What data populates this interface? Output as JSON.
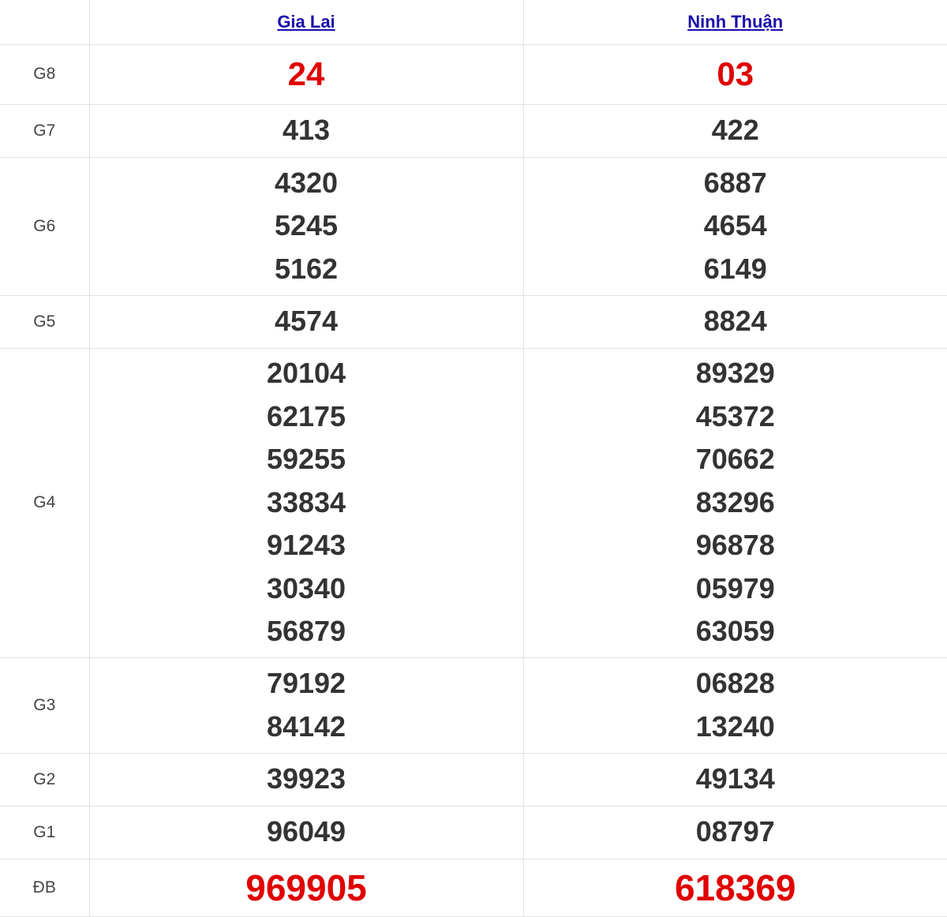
{
  "header": {
    "provinces": [
      "Gia Lai",
      "Ninh Thuận"
    ]
  },
  "prizes": {
    "g8": {
      "label": "G8",
      "gia_lai": [
        "24"
      ],
      "ninh_thuan": [
        "03"
      ]
    },
    "g7": {
      "label": "G7",
      "gia_lai": [
        "413"
      ],
      "ninh_thuan": [
        "422"
      ]
    },
    "g6": {
      "label": "G6",
      "gia_lai": [
        "4320",
        "5245",
        "5162"
      ],
      "ninh_thuan": [
        "6887",
        "4654",
        "6149"
      ]
    },
    "g5": {
      "label": "G5",
      "gia_lai": [
        "4574"
      ],
      "ninh_thuan": [
        "8824"
      ]
    },
    "g4": {
      "label": "G4",
      "gia_lai": [
        "20104",
        "62175",
        "59255",
        "33834",
        "91243",
        "30340",
        "56879"
      ],
      "ninh_thuan": [
        "89329",
        "45372",
        "70662",
        "83296",
        "96878",
        "05979",
        "63059"
      ]
    },
    "g3": {
      "label": "G3",
      "gia_lai": [
        "79192",
        "84142"
      ],
      "ninh_thuan": [
        "06828",
        "13240"
      ]
    },
    "g2": {
      "label": "G2",
      "gia_lai": [
        "39923"
      ],
      "ninh_thuan": [
        "49134"
      ]
    },
    "g1": {
      "label": "G1",
      "gia_lai": [
        "96049"
      ],
      "ninh_thuan": [
        "08797"
      ]
    },
    "db": {
      "label": "ĐB",
      "gia_lai": [
        "969905"
      ],
      "ninh_thuan": [
        "618369"
      ]
    }
  },
  "colors": {
    "highlight": "#e00000",
    "link": "#1a0dab",
    "number": "#333333",
    "border": "#e2e2e2"
  }
}
